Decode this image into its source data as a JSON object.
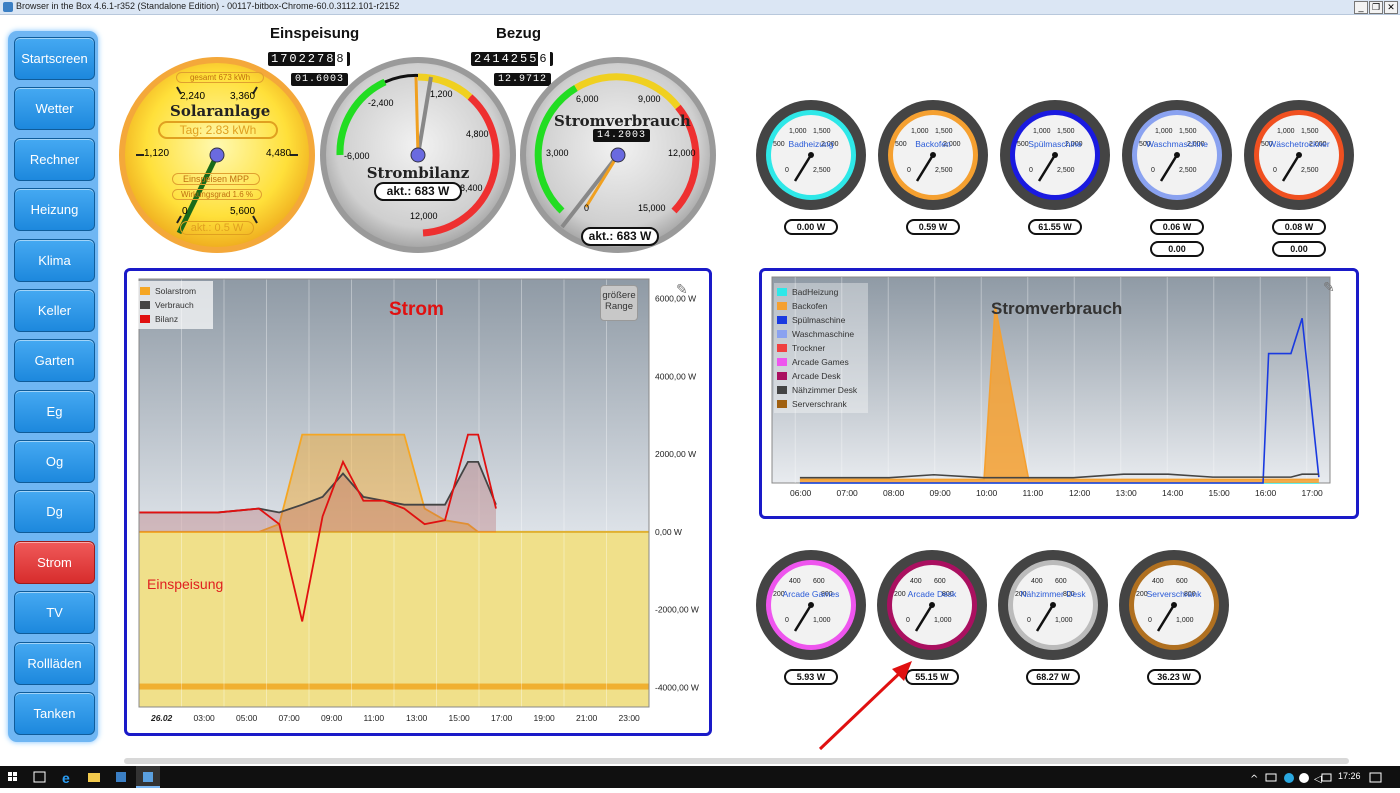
{
  "window": {
    "title": "Browser in the Box 4.6.1-r352 (Standalone Edition) - 00117-bitbox-Chrome-60.0.3112.101-r2152"
  },
  "sidebar": {
    "items": [
      {
        "label": "Startscreen"
      },
      {
        "label": "Wetter"
      },
      {
        "label": "Rechner"
      },
      {
        "label": "Heizung"
      },
      {
        "label": "Klima"
      },
      {
        "label": "Keller"
      },
      {
        "label": "Garten"
      },
      {
        "label": "Eg"
      },
      {
        "label": "Og"
      },
      {
        "label": "Dg"
      },
      {
        "label": "Strom"
      },
      {
        "label": "TV"
      },
      {
        "label": "Rollläden"
      },
      {
        "label": "Tanken"
      }
    ],
    "active": "Strom"
  },
  "counters": {
    "einspeisung": {
      "title": "Einspeisung",
      "value": "1702278",
      "value_last": "8",
      "value_full": "17022.7884",
      "small": "01.6003"
    },
    "bezug": {
      "title": "Bezug",
      "value": "2414255",
      "value_last": "6",
      "value_full": "24142.5562",
      "small": "12.9712"
    }
  },
  "gauges_main": {
    "solar": {
      "title": "Solaranlage",
      "gesamt": "gesamt 673 kWh",
      "tag": "Tag: 2.83 kWh",
      "mode": "Einspeisen MPP",
      "wirkung": "Wirkungsgrad 1.6 %",
      "akt": "akt.: 0.5 W",
      "ticks": [
        "1,120",
        "2,240",
        "3,360",
        "4,480",
        "5,600",
        "0"
      ]
    },
    "bilanz": {
      "title": "Strombilanz",
      "akt": "akt.: 683 W",
      "ticks": [
        "-6,000",
        "-2,400",
        "1,200",
        "4,800",
        "8,400",
        "12,000"
      ]
    },
    "verbrauch": {
      "title": "Stromverbrauch",
      "odo": "14.2003",
      "akt": "akt.: 683 W",
      "ticks": [
        "3,000",
        "6,000",
        "9,000",
        "12,000",
        "15,000",
        "0"
      ]
    }
  },
  "gauges_small_row1": [
    {
      "name": "Badheizung",
      "value": "0.00 W",
      "ring": "#2ee8e8"
    },
    {
      "name": "Backofen",
      "value": "0.59 W",
      "ring": "#f5a030"
    },
    {
      "name": "Spülmaschine",
      "value": "61.55 W",
      "ring": "#1a1ae0"
    },
    {
      "name": "Waschmaschine",
      "value": "0.06 W",
      "value2": "0.00",
      "ring": "#8aa2f0"
    },
    {
      "name": "Wäschetrockner",
      "value": "0.08 W",
      "value2": "0.00",
      "ring": "#f05020"
    }
  ],
  "gauges_small_row1_ticks": [
    "1,000",
    "1,500",
    "500",
    "2,000",
    "0",
    "2,500"
  ],
  "gauges_small_row2": [
    {
      "name": "Arcade Games",
      "value": "5.93 W",
      "ring": "#ee55ee"
    },
    {
      "name": "Arcade Desk",
      "value": "55.15 W",
      "ring": "#aa1060"
    },
    {
      "name": "Nähzimmer Desk",
      "value": "68.27 W",
      "ring": "#bbbbbb"
    },
    {
      "name": "Serverschrank",
      "value": "36.23 W",
      "ring": "#b07020"
    }
  ],
  "gauges_small_row2_ticks": [
    "400",
    "600",
    "200",
    "800",
    "0",
    "1,000"
  ],
  "chart_strom": {
    "title": "Strom",
    "annotation": "Einspeisung",
    "range_button": "größere Range",
    "legend": [
      {
        "name": "Solarstrom",
        "color": "#f5a623"
      },
      {
        "name": "Verbrauch",
        "color": "#444444"
      },
      {
        "name": "Bilanz",
        "color": "#e01010"
      }
    ],
    "y_ticks": [
      "6000,00 W",
      "4000,00 W",
      "2000,00 W",
      "0,00 W",
      "-2000,00 W",
      "-4000,00 W"
    ],
    "x_ticks": [
      "26.02",
      "03:00",
      "05:00",
      "07:00",
      "09:00",
      "11:00",
      "13:00",
      "15:00",
      "17:00",
      "19:00",
      "21:00",
      "23:00"
    ]
  },
  "chart_verbrauch": {
    "title": "Stromverbrauch",
    "legend": [
      {
        "name": "BadHeizung",
        "color": "#2ee8e8"
      },
      {
        "name": "Backofen",
        "color": "#f5a030"
      },
      {
        "name": "Spülmaschine",
        "color": "#1a3ae0"
      },
      {
        "name": "Waschmaschine",
        "color": "#8aa2f0"
      },
      {
        "name": "Trockner",
        "color": "#f04040"
      },
      {
        "name": "Arcade Games",
        "color": "#ee55ee"
      },
      {
        "name": "Arcade Desk",
        "color": "#aa1060"
      },
      {
        "name": "Nähzimmer Desk",
        "color": "#444444"
      },
      {
        "name": "Serverschrank",
        "color": "#a06010"
      }
    ],
    "x_ticks": [
      "06:00",
      "07:00",
      "08:00",
      "09:00",
      "10:00",
      "11:00",
      "12:00",
      "13:00",
      "14:00",
      "15:00",
      "16:00",
      "17:00"
    ]
  },
  "chart_data": [
    {
      "type": "area",
      "title": "Strom",
      "x": [
        "26.02",
        "03:00",
        "05:00",
        "07:00",
        "08:00",
        "09:00",
        "10:00",
        "11:00",
        "12:00",
        "13:00",
        "14:00",
        "15:00",
        "16:00",
        "16:40",
        "17:00",
        "17:20"
      ],
      "series": [
        {
          "name": "Solarstrom",
          "values": [
            0,
            0,
            0,
            0,
            200,
            2500,
            2500,
            2500,
            2500,
            2500,
            2500,
            600,
            300,
            200,
            0,
            0
          ]
        },
        {
          "name": "Verbrauch",
          "values": [
            500,
            500,
            500,
            600,
            500,
            700,
            900,
            1500,
            900,
            800,
            700,
            700,
            700,
            1800,
            1800,
            700
          ]
        },
        {
          "name": "Bilanz",
          "values": [
            500,
            500,
            500,
            600,
            200,
            -2300,
            400,
            1800,
            800,
            800,
            600,
            200,
            300,
            2500,
            2500,
            600
          ]
        }
      ],
      "ylim": [
        -4500,
        6500
      ]
    },
    {
      "type": "line",
      "title": "Stromverbrauch",
      "x": [
        "06:00",
        "07:00",
        "08:00",
        "09:00",
        "10:00",
        "10:15",
        "11:00",
        "12:00",
        "13:00",
        "14:00",
        "15:00",
        "16:00",
        "16:10",
        "16:40",
        "17:00",
        "17:15"
      ],
      "series": [
        {
          "name": "BadHeizung",
          "values": [
            0,
            0,
            0,
            0,
            0,
            0,
            0,
            0,
            0,
            0,
            0,
            0,
            0,
            0,
            0,
            0
          ]
        },
        {
          "name": "Backofen",
          "values": [
            60,
            60,
            60,
            60,
            60,
            3000,
            60,
            60,
            60,
            60,
            60,
            60,
            60,
            60,
            60,
            60
          ]
        },
        {
          "name": "Spülmaschine",
          "values": [
            0,
            0,
            0,
            0,
            0,
            0,
            0,
            0,
            0,
            0,
            0,
            0,
            2200,
            2200,
            2800,
            100
          ]
        },
        {
          "name": "Nähzimmer Desk",
          "values": [
            90,
            90,
            90,
            140,
            90,
            90,
            90,
            90,
            150,
            150,
            100,
            100,
            100,
            100,
            150,
            150
          ]
        }
      ]
    }
  ]
}
